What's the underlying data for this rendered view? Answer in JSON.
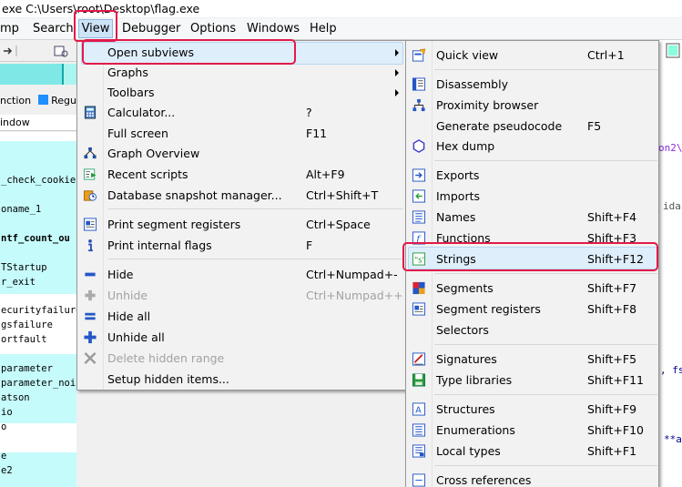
{
  "title_bar": {
    "text": "exe C:\\Users\\root\\Desktop\\flag.exe"
  },
  "menubar": {
    "items": [
      "mp",
      "Search",
      "View",
      "Debugger",
      "Options",
      "Windows",
      "Help"
    ]
  },
  "left_pane": {
    "header_fragment_1": "nction",
    "header_fragment_2": "Regu",
    "window_label": "indow",
    "rows": [
      "_check_cookie(",
      "oname_1",
      "ntf_count_ou",
      "TStartup",
      "r_exit",
      "ecurityfailure",
      "gsfailure",
      "ortfault",
      "parameter",
      "parameter_noin",
      "atson",
      "io",
      "o",
      "e",
      "e2"
    ]
  },
  "right_fragments": {
    "r1": "on2\\",
    "r2": "ida",
    "r3": ", fs",
    "r4": "**a"
  },
  "view_menu": {
    "items": [
      {
        "label": "Open subviews",
        "shortcut": "",
        "icon": "none",
        "disabled": false,
        "submenu": true
      },
      {
        "label": "Graphs",
        "shortcut": "",
        "icon": "none",
        "disabled": false,
        "submenu": true
      },
      {
        "label": "Toolbars",
        "shortcut": "",
        "icon": "none",
        "disabled": false,
        "submenu": true
      },
      {
        "label": "Calculator...",
        "shortcut": "?",
        "icon": "calculator-icon",
        "disabled": false,
        "submenu": false
      },
      {
        "label": "Full screen",
        "shortcut": "F11",
        "icon": "none",
        "disabled": false,
        "submenu": false
      },
      {
        "label": "Graph Overview",
        "shortcut": "",
        "icon": "graph-overview-icon",
        "disabled": false,
        "submenu": false
      },
      {
        "label": "Recent scripts",
        "shortcut": "Alt+F9",
        "icon": "recent-scripts-icon",
        "disabled": false,
        "submenu": false
      },
      {
        "label": "Database snapshot manager...",
        "shortcut": "Ctrl+Shift+T",
        "icon": "snapshot-manager-icon",
        "disabled": false,
        "submenu": false
      },
      {
        "label": "Print segment registers",
        "shortcut": "Ctrl+Space",
        "icon": "segment-registers-icon",
        "disabled": false,
        "submenu": false
      },
      {
        "label": "Print internal flags",
        "shortcut": "F",
        "icon": "info-icon",
        "disabled": false,
        "submenu": false
      },
      {
        "label": "Hide",
        "shortcut": "Ctrl+Numpad+-",
        "icon": "minus-icon",
        "disabled": false,
        "submenu": false
      },
      {
        "label": "Unhide",
        "shortcut": "Ctrl+Numpad++",
        "icon": "plus-icon",
        "disabled": true,
        "submenu": false
      },
      {
        "label": "Hide all",
        "shortcut": "",
        "icon": "hide-all-icon",
        "disabled": false,
        "submenu": false
      },
      {
        "label": "Unhide all",
        "shortcut": "",
        "icon": "unhide-all-icon",
        "disabled": false,
        "submenu": false
      },
      {
        "label": "Delete hidden range",
        "shortcut": "",
        "icon": "delete-x-icon",
        "disabled": true,
        "submenu": false
      },
      {
        "label": "Setup hidden items...",
        "shortcut": "",
        "icon": "none",
        "disabled": false,
        "submenu": false
      }
    ]
  },
  "subviews_menu": {
    "items": [
      {
        "label": "Quick view",
        "shortcut": "Ctrl+1",
        "icon": "quick-view-icon"
      },
      {
        "label": "Disassembly",
        "shortcut": "",
        "icon": "disassembly-icon"
      },
      {
        "label": "Proximity browser",
        "shortcut": "",
        "icon": "proximity-browser-icon"
      },
      {
        "label": "Generate pseudocode",
        "shortcut": "F5",
        "icon": "none"
      },
      {
        "label": "Hex dump",
        "shortcut": "",
        "icon": "hex-dump-icon"
      },
      {
        "label": "Exports",
        "shortcut": "",
        "icon": "exports-icon"
      },
      {
        "label": "Imports",
        "shortcut": "",
        "icon": "imports-icon"
      },
      {
        "label": "Names",
        "shortcut": "Shift+F4",
        "icon": "names-icon"
      },
      {
        "label": "Functions",
        "shortcut": "Shift+F3",
        "icon": "functions-icon"
      },
      {
        "label": "Strings",
        "shortcut": "Shift+F12",
        "icon": "strings-icon"
      },
      {
        "label": "Segments",
        "shortcut": "Shift+F7",
        "icon": "segments-icon"
      },
      {
        "label": "Segment registers",
        "shortcut": "Shift+F8",
        "icon": "segment-registers-icon"
      },
      {
        "label": "Selectors",
        "shortcut": "",
        "icon": "none"
      },
      {
        "label": "Signatures",
        "shortcut": "Shift+F5",
        "icon": "signatures-icon"
      },
      {
        "label": "Type libraries",
        "shortcut": "Shift+F11",
        "icon": "type-libraries-icon"
      },
      {
        "label": "Structures",
        "shortcut": "Shift+F9",
        "icon": "structures-icon"
      },
      {
        "label": "Enumerations",
        "shortcut": "Shift+F10",
        "icon": "enumerations-icon"
      },
      {
        "label": "Local types",
        "shortcut": "Shift+F1",
        "icon": "local-types-icon"
      },
      {
        "label": "Cross references",
        "shortcut": "",
        "icon": "cross-references-icon"
      }
    ]
  }
}
